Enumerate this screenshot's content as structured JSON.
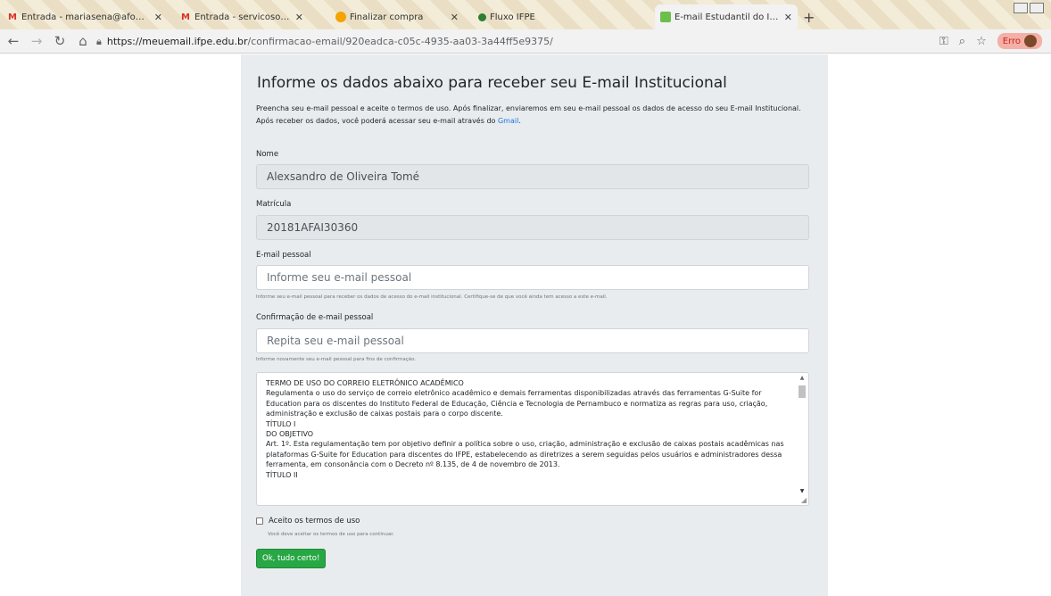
{
  "browser": {
    "tabs": [
      {
        "title": "Entrada - mariasena@afogado",
        "icon": "gmail-icon"
      },
      {
        "title": "Entrada - servicosocial.afogado",
        "icon": "gmail-icon"
      },
      {
        "title": "Finalizar compra",
        "icon": "orange-icon"
      },
      {
        "title": "Fluxo IFPE",
        "icon": "dot-icon"
      },
      {
        "title": "E-mail Estudantil do IFPE",
        "icon": "site-icon"
      }
    ],
    "url_host": "https://meuemail.ifpe.edu.br",
    "url_path": "/confirmacao-email/920eadca-c05c-4935-aa03-3a44ff5e9375/",
    "profile_label": "Erro"
  },
  "form": {
    "title": "Informe os dados abaixo para receber seu E-mail Institucional",
    "intro_text": "Preencha seu e-mail pessoal e aceite o termos de uso. Após finalizar, enviaremos em seu e-mail pessoal os dados de acesso do seu E-mail Institucional. Após receber os dados, você poderá acessar seu e-mail através do ",
    "intro_link": "Gmail",
    "intro_end": ".",
    "nome_label": "Nome",
    "nome_value": "Alexsandro de Oliveira Tomé",
    "matricula_label": "Matrícula",
    "matricula_value": "20181AFAI30360",
    "email_label": "E-mail pessoal",
    "email_placeholder": "Informe seu e-mail pessoal",
    "email_help": "Informe seu e-mail pessoal para receber os dados de acesso do e-mail institucional. Certifique-se de que você ainda tem acesso a este e-mail.",
    "confirm_label": "Confirmação de e-mail pessoal",
    "confirm_placeholder": "Repita seu e-mail pessoal",
    "confirm_help": "Informe novamente seu e-mail pessoal para fins de confirmação.",
    "terms_lines": [
      "TERMO DE USO DO CORREIO ELETRÔNICO ACADÊMICO",
      "Regulamenta o uso do serviço de correio eletrônico acadêmico e demais ferramentas disponibilizadas através das ferramentas G-Suite for Education para os discentes do Instituto Federal de Educação, Ciência e Tecnologia de Pernambuco e normatiza as regras para uso, criação, administração e exclusão de caixas postais para o corpo discente.",
      "TÍTULO I",
      "DO OBJETIVO",
      "Art. 1º. Esta regulamentação tem por objetivo definir a política sobre o uso, criação, administração e exclusão de caixas postais acadêmicas nas plataformas G-Suite for Education para discentes do IFPE, estabelecendo as diretrizes a serem seguidas pelos usuários e administradores dessa ferramenta, em consonância com o Decreto nº 8.135, de 4 de novembro de 2013.",
      "TÍTULO II"
    ],
    "accept_label": "Aceito os termos de uso",
    "accept_help": "Você deve aceitar os termos de uso para continuar.",
    "submit_label": "Ok, tudo certo!"
  }
}
